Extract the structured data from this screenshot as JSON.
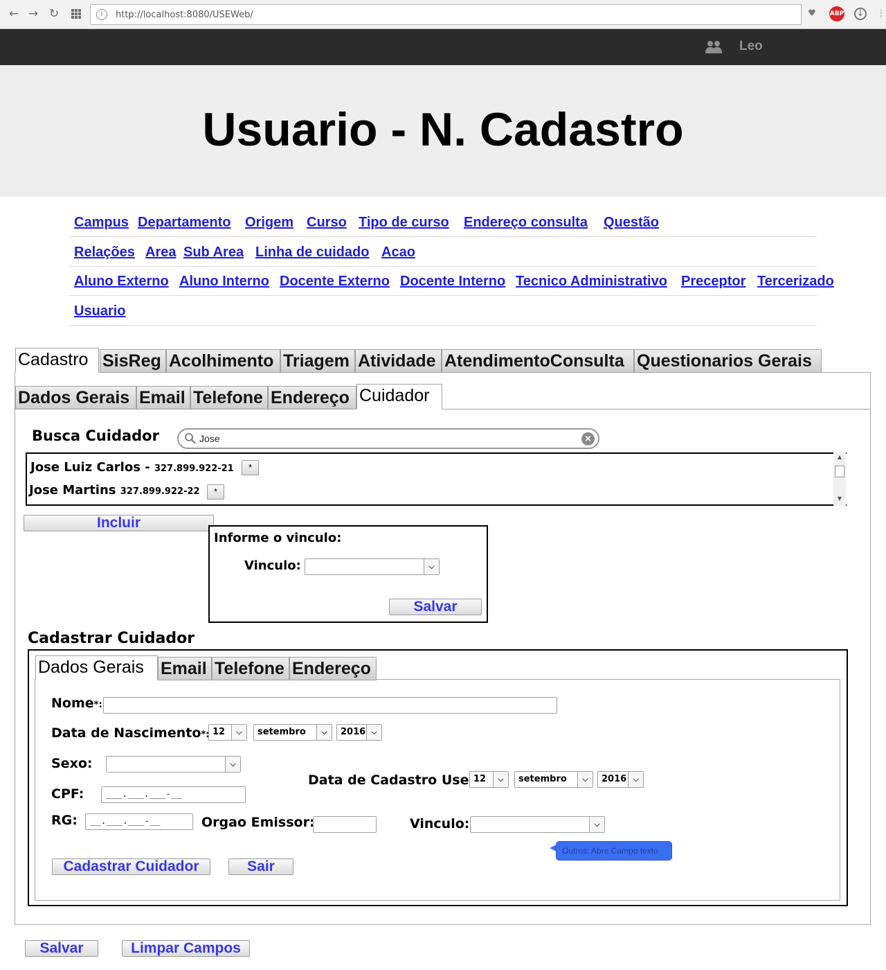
{
  "browser": {
    "url": "http://localhost:8080/USEWeb/",
    "back_icon": "arrow-left",
    "forward_icon": "arrow-right",
    "reload_icon": "reload",
    "apps_icon": "grid",
    "adblock_label": "ABP"
  },
  "header": {
    "user_name": "Leo",
    "page_title": "Usuario - N. Cadastro"
  },
  "nav": {
    "rows": [
      [
        "Campus",
        "Departamento",
        "Origem",
        "Curso",
        "Tipo de curso",
        "Endereço consulta",
        "Questão"
      ],
      [
        "Relações",
        "Area",
        "Sub Area",
        "Linha de cuidado",
        "Acao"
      ],
      [
        "Aluno Externo",
        "Aluno Interno",
        "Docente Externo",
        "Docente Interno",
        "Tecnico Administrativo",
        "Preceptor",
        "Tercerizado"
      ],
      [
        "Usuario"
      ]
    ]
  },
  "main_tabs": [
    "Cadastro",
    "SisReg",
    "Acolhimento",
    "Triagem",
    "Atividade",
    "AtendimentoConsulta",
    "Questionarios Gerais"
  ],
  "sub_tabs": [
    "Dados Gerais",
    "Email",
    "Telefone",
    "Endereço",
    "Cuidador"
  ],
  "busca": {
    "label": "Busca Cuidador",
    "search_value": "Jose",
    "results": [
      {
        "name": "Jose Luiz Carlos",
        "separator": " - ",
        "cpf": "327.899.922-21",
        "action": "*"
      },
      {
        "name": "Jose Martins",
        "separator": " ",
        "cpf": "327.899.922-22",
        "action": "*"
      }
    ],
    "include_button": "Incluir"
  },
  "vinculo_popup": {
    "title": "Informe o vinculo:",
    "vinculo_label": "Vinculo:",
    "vinculo_value": "",
    "save_button": "Salvar"
  },
  "cadastrar": {
    "title": "Cadastrar Cuidador",
    "tabs": [
      "Dados Gerais",
      "Email",
      "Telefone",
      "Endereço"
    ],
    "nome_label": "Nome",
    "required_mark": "*",
    "colon": ":",
    "nome_value": "",
    "nascimento_label": "Data de Nascimento",
    "nascimento": {
      "day": "12",
      "month": "setembro",
      "year": "2016"
    },
    "sexo_label": "Sexo:",
    "sexo_value": "",
    "cpf_label": "CPF:",
    "cpf_mask": "___.___.___-__",
    "rg_label": "RG:",
    "rg_mask": "__.___.___-__",
    "orgao_label": "Orgao Emissor:",
    "orgao_value": "",
    "data_cadastro_label": "Data de Cadastro Use:",
    "data_cadastro": {
      "day": "12",
      "month": "setembro",
      "year": "2016"
    },
    "vinculo_label": "Vinculo:",
    "vinculo_value": "",
    "tooltip": "Outros: Abre Campo texto",
    "submit_button": "Cadastrar Cuidador",
    "exit_button": "Sair"
  },
  "footer": {
    "save_button": "Salvar",
    "clear_button": "Limpar Campos"
  },
  "colors": {
    "link": "#1f1fd9",
    "button_text": "#3737e8",
    "topbar": "#2b2b2b",
    "banner": "#eeeeee",
    "tooltip": "#3b6ff2"
  }
}
